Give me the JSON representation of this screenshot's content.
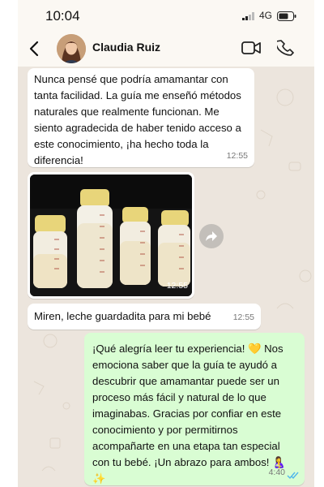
{
  "status_bar": {
    "time": "10:04",
    "network": "4G"
  },
  "header": {
    "contact_name": "Claudia Ruiz",
    "icons": [
      "back-arrow-icon",
      "avatar",
      "video-call-icon",
      "phone-icon"
    ]
  },
  "messages": [
    {
      "direction": "incoming",
      "text": "Nunca pensé que podría amamantar con tanta facilidad. La guía me enseñó métodos naturales que realmente funcionan. Me siento agradecida de haber tenido acceso a este conocimiento, ¡ha hecho toda la diferencia!",
      "time": "12:55"
    },
    {
      "direction": "incoming",
      "type": "image",
      "description_icon": "photo-breast-milk-bottles",
      "time": "12:55"
    },
    {
      "direction": "incoming",
      "text": "Miren, leche guardadita para mi bebé",
      "time": "12:55"
    },
    {
      "direction": "outgoing",
      "text": "¡Qué alegría leer tu experiencia! 💛 Nos emociona saber que la guía te ayudó a descubrir que amamantar puede ser un proceso más fácil y natural de lo que imaginabas. Gracias por confiar en este conocimiento y por permitirnos acompañarte en una etapa tan especial con tu bebé. ¡Un abrazo para ambos! 🤱✨",
      "time": "4:40",
      "status": "read"
    }
  ],
  "colors": {
    "wallpaper": "#ece5dd",
    "incoming_bubble": "#ffffff",
    "outgoing_bubble": "#d9fdd3",
    "read_ticks": "#4fb6ec"
  }
}
